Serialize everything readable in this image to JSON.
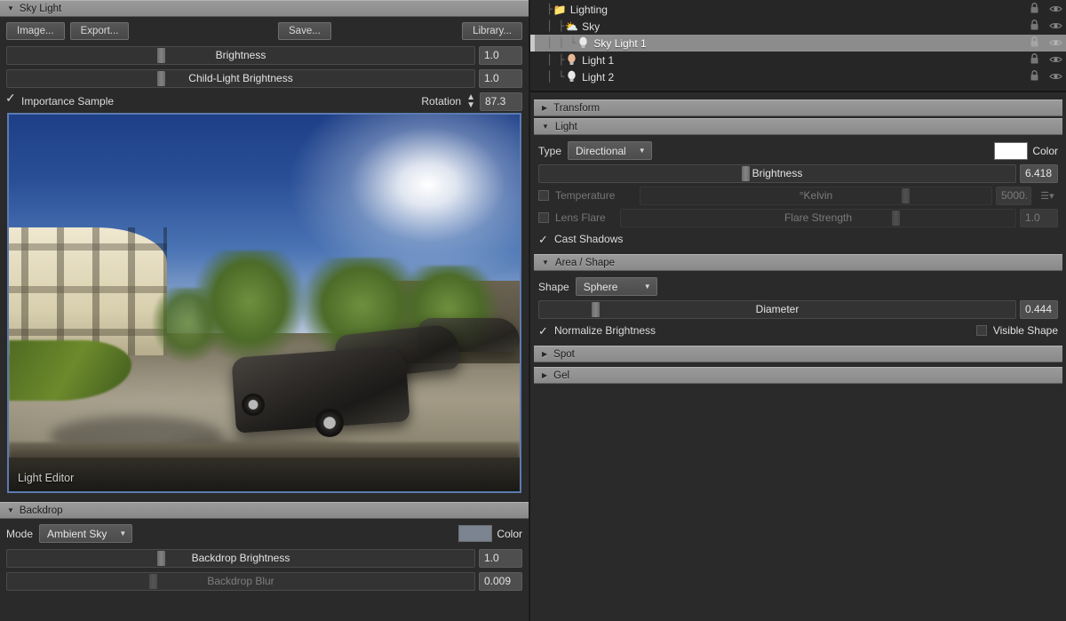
{
  "sky_light": {
    "header": "Sky Light",
    "tri": "▼",
    "buttons": {
      "image": "Image...",
      "export": "Export...",
      "save": "Save...",
      "library": "Library..."
    },
    "brightness": {
      "label": "Brightness",
      "value": "1.0"
    },
    "child_light_brightness": {
      "label": "Child-Light Brightness",
      "value": "1.0"
    },
    "importance_sample": {
      "label": "Importance Sample",
      "checked": true
    },
    "rotation": {
      "label": "Rotation",
      "value": "87.3"
    },
    "preview_watermark": "Light Editor"
  },
  "backdrop": {
    "header": "Backdrop",
    "tri": "▼",
    "mode_label": "Mode",
    "mode_value": "Ambient Sky",
    "color_label": "Color",
    "color_swatch": "#7b8490",
    "brightness": {
      "label": "Backdrop Brightness",
      "value": "1.0"
    },
    "blur": {
      "label": "Backdrop Blur",
      "value": "0.009"
    }
  },
  "tree": {
    "items": [
      {
        "label": "Lighting",
        "icon": "folder-icon",
        "glyph": "📁",
        "depth": 0,
        "selected": false,
        "lines": "├"
      },
      {
        "label": "Sky",
        "icon": "sun-cloud-icon",
        "glyph": "⛅",
        "depth": 1,
        "selected": false,
        "lines": "│ ├"
      },
      {
        "label": "Sky Light 1",
        "icon": "light-bulb-icon",
        "glyph": "💡",
        "depth": 2,
        "selected": true,
        "lines": "│ │ └"
      },
      {
        "label": "Light 1",
        "icon": "light-bulb-icon",
        "glyph": "💡",
        "depth": 1,
        "selected": false,
        "lines": "│ ├"
      },
      {
        "label": "Light 2",
        "icon": "light-bulb-icon",
        "glyph": "💡",
        "depth": 1,
        "selected": false,
        "lines": "│ └"
      }
    ],
    "lock_title": "lock",
    "eye_title": "visibility"
  },
  "transform": {
    "header": "Transform",
    "tri": "▶"
  },
  "light": {
    "header": "Light",
    "tri": "▼",
    "type_label": "Type",
    "type_value": "Directional",
    "color_label": "Color",
    "color_swatch": "#ffffff",
    "brightness": {
      "label": "Brightness",
      "value": "6.418"
    },
    "temperature": {
      "label": "Temperature",
      "slider_label": "°Kelvin",
      "value": "5000.",
      "checked": false
    },
    "lens_flare": {
      "label": "Lens Flare",
      "slider_label": "Flare Strength",
      "value": "1.0",
      "checked": false
    },
    "cast_shadows": {
      "label": "Cast Shadows",
      "checked": true
    }
  },
  "area_shape": {
    "header": "Area / Shape",
    "tri": "▼",
    "shape_label": "Shape",
    "shape_value": "Sphere",
    "diameter": {
      "label": "Diameter",
      "value": "0.444"
    },
    "normalize_brightness": {
      "label": "Normalize Brightness",
      "checked": true
    },
    "visible_shape": {
      "label": "Visible Shape",
      "checked": false
    }
  },
  "spot": {
    "header": "Spot",
    "tri": "▶"
  },
  "gel": {
    "header": "Gel",
    "tri": "▶"
  }
}
